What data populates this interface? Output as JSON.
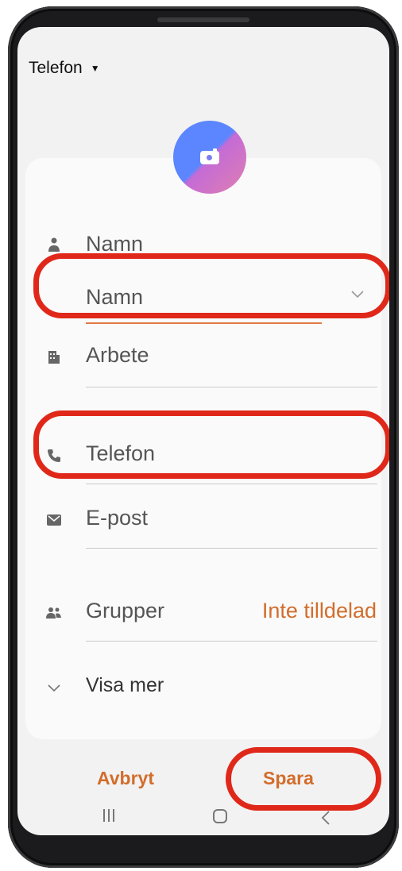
{
  "header": {
    "account_label": "Telefon",
    "account_caret": "▼"
  },
  "form": {
    "name_section_label": "Namn",
    "name_input_value": "Namn",
    "work_label": "Arbete",
    "phone_label": "Telefon",
    "email_label": "E-post",
    "groups_label": "Grupper",
    "groups_value": "Inte tilldelad",
    "show_more_label": "Visa mer"
  },
  "actions": {
    "cancel_label": "Avbryt",
    "save_label": "Spara"
  },
  "colors": {
    "accent": "#d26d2c",
    "highlight": "#e0281a"
  },
  "icons": [
    "person-icon",
    "chevron-down-icon",
    "building-icon",
    "phone-icon",
    "email-icon",
    "group-icon",
    "camera-icon"
  ]
}
